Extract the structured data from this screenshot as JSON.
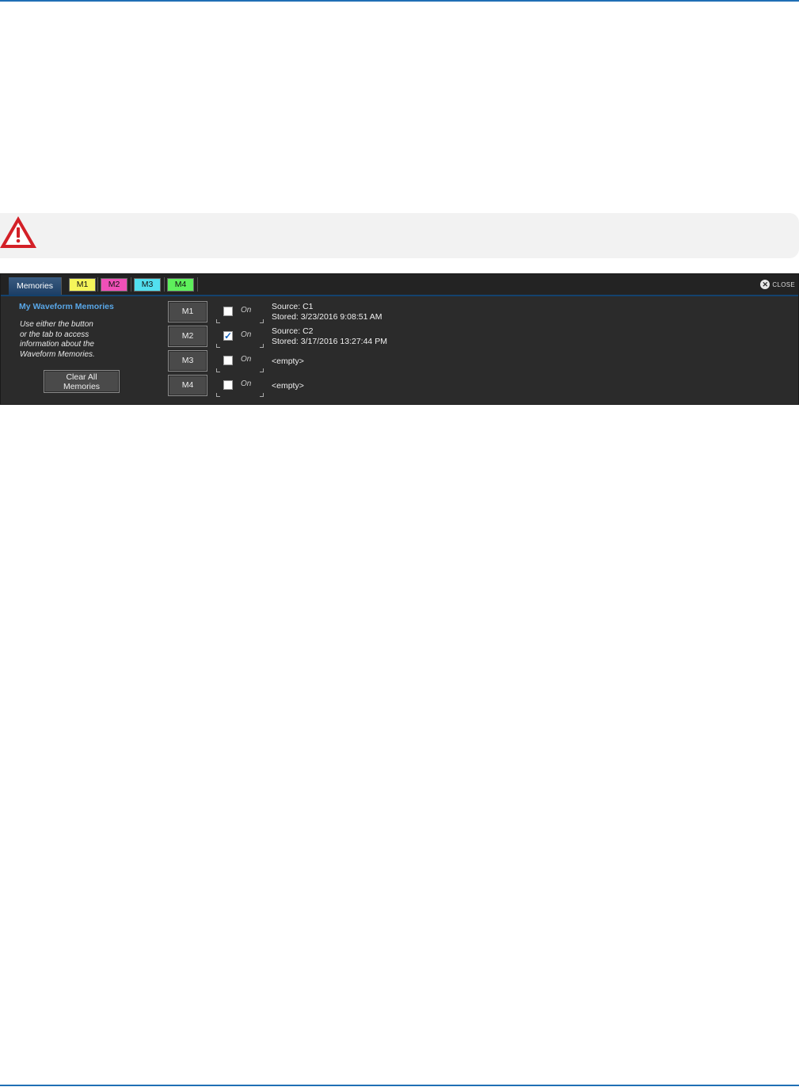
{
  "colors": {
    "rule": "#1f6fb5",
    "m1": "#f6f65a",
    "m2": "#f050b8",
    "m3": "#52e0ef",
    "m4": "#5ef05c",
    "panel_bg": "#2b2b2b",
    "title_blue": "#59a7e8"
  },
  "caution": {
    "icon": "warning-triangle-icon"
  },
  "panel": {
    "tabs": {
      "memories": "Memories",
      "m1": "M1",
      "m2": "M2",
      "m3": "M3",
      "m4": "M4"
    },
    "close_label": "CLOSE",
    "title": "My Waveform Memories",
    "help_lines": [
      "Use either the button",
      "or the tab to access",
      "information about the",
      "Waveform Memories."
    ],
    "clear_all": {
      "line1": "Clear All",
      "line2": "Memories"
    },
    "memories": [
      {
        "label": "M1",
        "on_label": "On",
        "checked": false,
        "source": "Source: C1",
        "stored": "Stored: 3/23/2016 9:08:51 AM"
      },
      {
        "label": "M2",
        "on_label": "On",
        "checked": true,
        "source": "Source: C2",
        "stored": "Stored: 3/17/2016 13:27:44 PM"
      },
      {
        "label": "M3",
        "on_label": "On",
        "checked": false,
        "empty": "<empty>"
      },
      {
        "label": "M4",
        "on_label": "On",
        "checked": false,
        "empty": "<empty>"
      }
    ]
  }
}
